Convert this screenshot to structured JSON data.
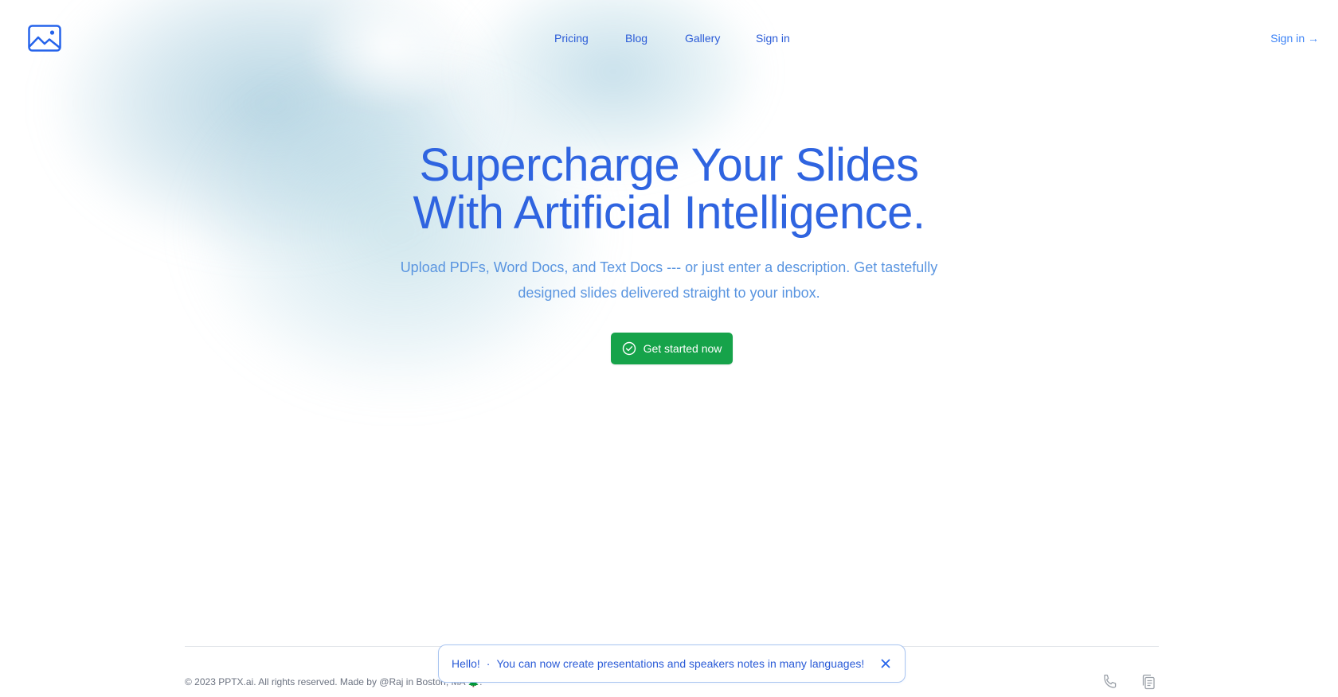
{
  "header": {
    "logo_icon": "image-icon",
    "nav": [
      {
        "label": "Pricing"
      },
      {
        "label": "Blog"
      },
      {
        "label": "Gallery"
      },
      {
        "label": "Sign in"
      }
    ],
    "signin_label": "Sign in →"
  },
  "hero": {
    "title_line1": "Supercharge Your Slides",
    "title_line2": "With Artificial Intelligence.",
    "subtitle": "Upload PDFs, Word Docs, and Text Docs --- or just enter a description. Get tastefully designed slides delivered straight to your inbox.",
    "cta_label": "Get started now",
    "cta_icon": "check-circle-icon"
  },
  "footer": {
    "copyright": "© 2023 PPTX.ai. All rights reserved. Made by @Raj in Boston, MA 🌲.",
    "icons": [
      "phone-icon",
      "copy-icon"
    ]
  },
  "toast": {
    "hello": "Hello!",
    "separator": "·",
    "message": "You can now create presentations and speakers notes in many languages!",
    "close_icon": "close-icon"
  },
  "colors": {
    "brand_blue": "#2563eb",
    "cta_green": "#16a34a",
    "subtitle_blue": "#5a95e0"
  }
}
